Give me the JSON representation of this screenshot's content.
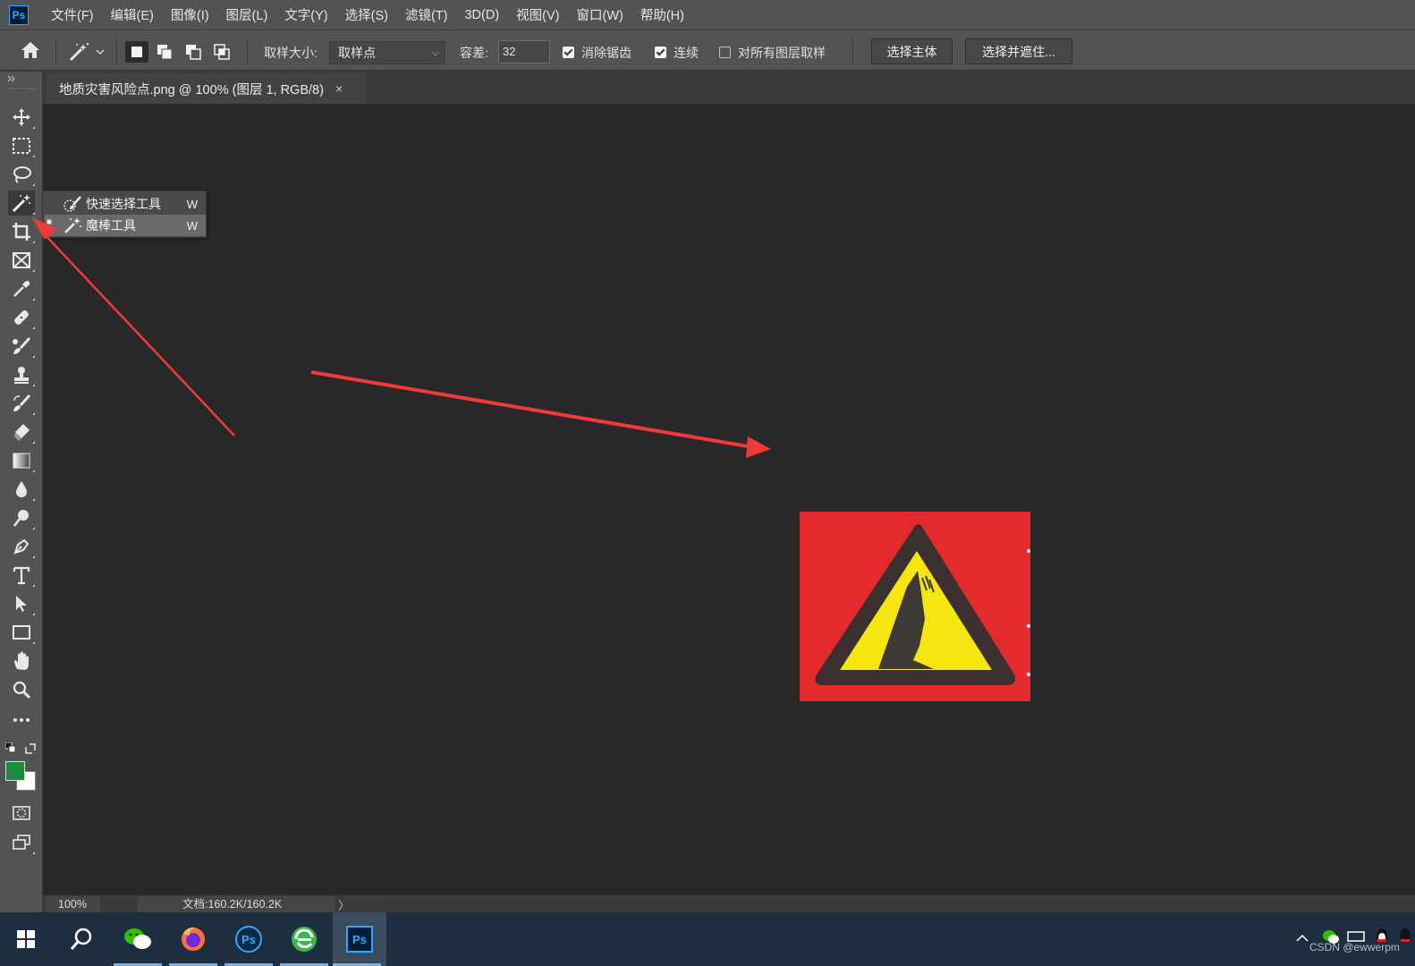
{
  "app": {
    "logo": "Ps"
  },
  "menubar": {
    "items": [
      "文件(F)",
      "编辑(E)",
      "图像(I)",
      "图层(L)",
      "文字(Y)",
      "选择(S)",
      "滤镜(T)",
      "3D(D)",
      "视图(V)",
      "窗口(W)",
      "帮助(H)"
    ]
  },
  "options": {
    "sample_size_label": "取样大小:",
    "sample_size_value": "取样点",
    "tolerance_label": "容差:",
    "tolerance_value": "32",
    "antialias_label": "消除锯齿",
    "antialias_checked": true,
    "contiguous_label": "连续",
    "contiguous_checked": true,
    "sample_all_layers_label": "对所有图层取样",
    "sample_all_layers_checked": false,
    "select_subject_label": "选择主体",
    "select_mask_label": "选择并遮住..."
  },
  "toolbox": {
    "tools": [
      "move-tool",
      "marquee-tool",
      "lasso-tool",
      "magic-wand-tool",
      "crop-tool",
      "frame-tool",
      "eyedropper-tool",
      "healing-brush-tool",
      "brush-tool",
      "clone-stamp-tool",
      "history-brush-tool",
      "eraser-tool",
      "gradient-tool",
      "blur-tool",
      "dodge-tool",
      "pen-tool",
      "type-tool",
      "path-selection-tool",
      "rectangle-tool",
      "hand-tool",
      "zoom-tool",
      "edit-toolbar"
    ],
    "foreground_color": "#1e8a3e",
    "background_color": "#ffffff"
  },
  "flyout": {
    "items": [
      {
        "label": "快速选择工具",
        "shortcut": "W",
        "icon": "quick-selection-icon"
      },
      {
        "label": "魔棒工具",
        "shortcut": "W",
        "icon": "magic-wand-icon"
      }
    ]
  },
  "document": {
    "tab_title": "地质灾害风险点.png @ 100% (图层 1, RGB/8)",
    "tab_close": "×",
    "image_colors": {
      "background": "#e32b2e",
      "triangle_border": "#3c2f2f",
      "triangle_fill": "#f5e60f",
      "figure": "#3f3a36"
    }
  },
  "status": {
    "zoom": "100%",
    "doc_info": "文档:160.2K/160.2K",
    "arrow": "〉"
  },
  "annotations": {
    "arrow_color": "#f03a3a"
  },
  "taskbar": {
    "apps": [
      "windows-start",
      "search",
      "wechat",
      "firefox",
      "photoshop-alt",
      "browser-360",
      "photoshop"
    ],
    "watermark": "CSDN @ewwerpm"
  }
}
